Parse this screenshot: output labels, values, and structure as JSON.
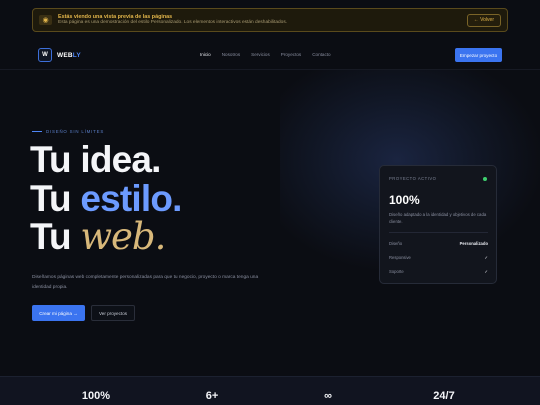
{
  "banner": {
    "title": "Estás viendo una vista previa de las páginas",
    "subtitle": "Esta página es una demostración del estilo Personalizado. Los elementos interactivos están deshabilitados.",
    "back_label": "← Volver",
    "eye_icon": "eye-icon"
  },
  "nav": {
    "logo_mark": "W",
    "logo_text_main": "WEB",
    "logo_text_accent": "LY",
    "items": [
      {
        "label": "Inicio",
        "active": true
      },
      {
        "label": "Nosotros",
        "active": false
      },
      {
        "label": "Servicios",
        "active": false
      },
      {
        "label": "Proyectos",
        "active": false
      },
      {
        "label": "Contacto",
        "active": false
      }
    ],
    "cta": "Empezar proyecto"
  },
  "hero": {
    "eyebrow": "DISEÑO SIN LÍMITES",
    "line1": "Tu idea.",
    "line2_prefix": "Tu ",
    "line2_accent": "estilo.",
    "line3_prefix": "Tu ",
    "line3_accent": "web.",
    "description": "Diseñamos páginas web completamente personalizadas para que tu negocio, proyecto o marca tenga una identidad propia.",
    "primary_button": "Crear mi página →",
    "secondary_button": "Ver proyectos"
  },
  "card": {
    "label": "PROYECTO ACTIVO",
    "value": "100%",
    "description": "Diseño adaptado a la identidad y objetivos de cada cliente.",
    "rows": [
      {
        "key": "Diseño",
        "value": "Personalizado"
      },
      {
        "key": "Responsive",
        "value": "✓"
      },
      {
        "key": "Soporte",
        "value": "✓"
      }
    ],
    "status_color": "#3ecf6e"
  },
  "stats": [
    "100%",
    "6+",
    "∞",
    "24/7"
  ],
  "colors": {
    "accent": "#3b74f0",
    "accent_light": "#6c9bff",
    "gold": "#d8b87a",
    "banner_gold": "#e0b44a",
    "background": "#0b0d13"
  }
}
